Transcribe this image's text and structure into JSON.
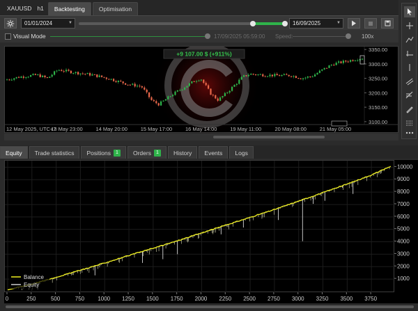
{
  "topbar": {
    "symbol": "XAUUSD",
    "timeframe": "h1",
    "tabs": [
      {
        "label": "Backtesting",
        "active": true
      },
      {
        "label": "Optimisation",
        "active": false
      }
    ]
  },
  "controls": {
    "start_date": "01/01/2024",
    "end_date": "16/09/2025",
    "visual_mode_label": "Visual Mode",
    "visual_mode_time": "17/09/2025 05:59:00",
    "speed_label": "Speed:",
    "speed_value": "100x"
  },
  "price_chart": {
    "profit_label": "+9 107.00 $ (+911%)",
    "y_ticks": [
      "3350.00",
      "3300.00",
      "3250.00",
      "3200.00",
      "3150.00",
      "3100.00"
    ],
    "x_ticks": [
      "12 May 2025, UTC+7",
      "13 May 23:00",
      "14 May 20:00",
      "15 May 17:00",
      "16 May 14:00",
      "19 May 11:00",
      "20 May 08:00",
      "21 May 05:00"
    ],
    "y_min": 3090,
    "y_max": 3360,
    "bull_color": "#2fb34a",
    "bear_color": "#e8674a"
  },
  "bottom_tabs": [
    {
      "label": "Equity",
      "active": true,
      "badge": ""
    },
    {
      "label": "Trade statistics",
      "active": false,
      "badge": ""
    },
    {
      "label": "Positions",
      "active": false,
      "badge": "1"
    },
    {
      "label": "Orders",
      "active": false,
      "badge": "1"
    },
    {
      "label": "History",
      "active": false,
      "badge": ""
    },
    {
      "label": "Events",
      "active": false,
      "badge": ""
    },
    {
      "label": "Logs",
      "active": false,
      "badge": ""
    }
  ],
  "chart_data": {
    "type": "line",
    "title": "",
    "xlabel": "",
    "ylabel": "",
    "xlim": [
      0,
      3950
    ],
    "ylim": [
      0,
      10300
    ],
    "x_ticks": [
      0,
      250,
      500,
      750,
      1000,
      1250,
      1500,
      1750,
      2000,
      2250,
      2500,
      2750,
      3000,
      3250,
      3500,
      3750
    ],
    "y_ticks": [
      1000,
      2000,
      3000,
      4000,
      5000,
      6000,
      7000,
      8000,
      9000,
      10000
    ],
    "legend_position": "bottom-left",
    "series": [
      {
        "name": "Balance",
        "color": "#f0f020",
        "x": [
          0,
          250,
          500,
          750,
          1000,
          1250,
          1500,
          1750,
          2000,
          2250,
          2500,
          2750,
          3000,
          3250,
          3500,
          3750,
          3950
        ],
        "y": [
          150,
          600,
          1150,
          1720,
          2300,
          2900,
          3490,
          4080,
          4720,
          5350,
          5970,
          6600,
          7280,
          7960,
          8650,
          9380,
          10080
        ]
      },
      {
        "name": "Equity",
        "color": "#ffffff",
        "drawdowns": [
          {
            "x": 310,
            "y": 200
          },
          {
            "x": 900,
            "y": 1300
          },
          {
            "x": 1390,
            "y": 2300
          },
          {
            "x": 1600,
            "y": 2600
          },
          {
            "x": 1750,
            "y": 3000
          },
          {
            "x": 2200,
            "y": 4600
          },
          {
            "x": 2430,
            "y": 5150
          },
          {
            "x": 2790,
            "y": 5750
          },
          {
            "x": 3040,
            "y": 4050
          },
          {
            "x": 3150,
            "y": 7050
          },
          {
            "x": 3270,
            "y": 7300
          },
          {
            "x": 3450,
            "y": 8350
          },
          {
            "x": 3560,
            "y": 7850
          }
        ]
      }
    ]
  }
}
